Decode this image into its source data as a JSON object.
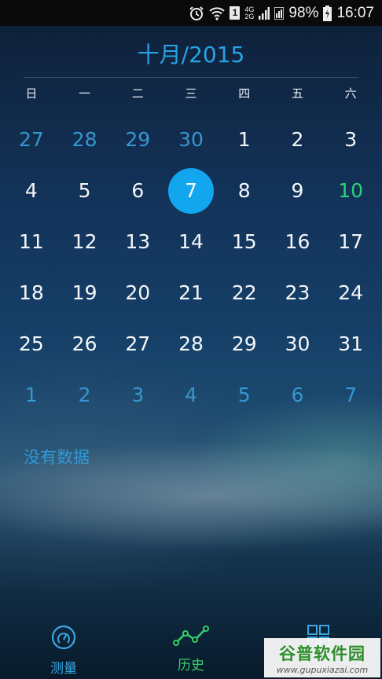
{
  "status_bar": {
    "network_top": "4G",
    "network_bottom": "2G",
    "sim_label": "1",
    "battery": "98%",
    "time": "16:07"
  },
  "calendar": {
    "title": "十月/2015",
    "weekdays": [
      "日",
      "一",
      "二",
      "三",
      "四",
      "五",
      "六"
    ],
    "weeks": [
      [
        "27",
        "28",
        "29",
        "30",
        "1",
        "2",
        "3"
      ],
      [
        "4",
        "5",
        "6",
        "7",
        "8",
        "9",
        "10"
      ],
      [
        "11",
        "12",
        "13",
        "14",
        "15",
        "16",
        "17"
      ],
      [
        "18",
        "19",
        "20",
        "21",
        "22",
        "23",
        "24"
      ],
      [
        "25",
        "26",
        "27",
        "28",
        "29",
        "30",
        "31"
      ],
      [
        "1",
        "2",
        "3",
        "4",
        "5",
        "6",
        "7"
      ]
    ],
    "selected_day": "7",
    "highlighted_day": "10"
  },
  "empty_message": "没有数据",
  "tabs": [
    {
      "label": "测量",
      "icon": "gauge-icon"
    },
    {
      "label": "历史",
      "icon": "line-chart-icon"
    },
    {
      "label": "",
      "icon": "grid-icon"
    }
  ],
  "watermark": {
    "title": "谷普软件园",
    "url": "www.gupuxiazai.com"
  },
  "colors": {
    "accent_blue": "#29a2e6",
    "selected_circle": "#12a6ee",
    "other_month_day": "#3696cf",
    "highlight_green": "#2fd07a"
  }
}
